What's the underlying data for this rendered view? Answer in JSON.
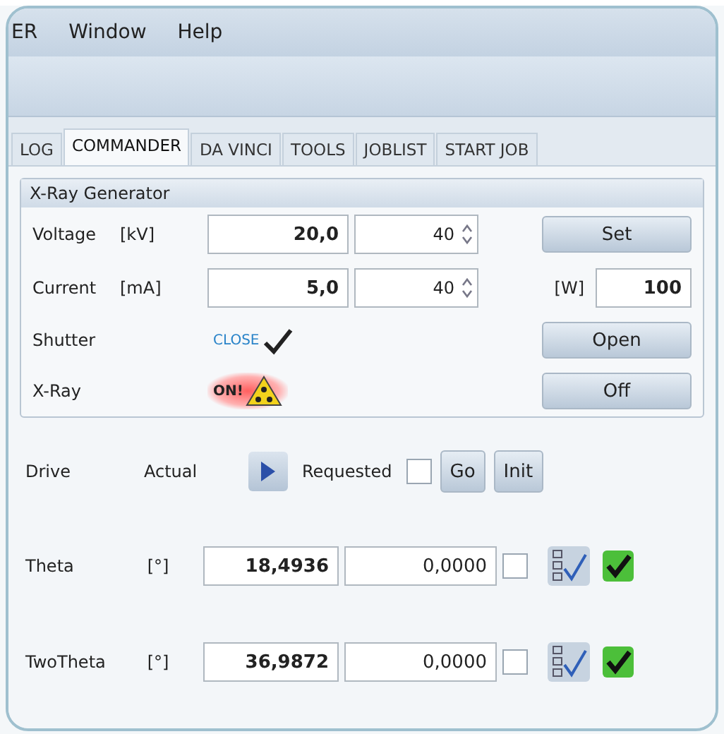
{
  "menu": [
    {
      "label": "ER"
    },
    {
      "label": "Window"
    },
    {
      "label": "Help"
    }
  ],
  "tabs": [
    {
      "label": "LOG",
      "selected": false
    },
    {
      "label": "COMMANDER",
      "selected": true
    },
    {
      "label": "DA VINCI",
      "selected": false
    },
    {
      "label": "TOOLS",
      "selected": false
    },
    {
      "label": "JOBLIST",
      "selected": false
    },
    {
      "label": "START JOB",
      "selected": false
    }
  ],
  "xray_generator": {
    "title": "X-Ray Generator",
    "setpoints": [
      {
        "label": "Voltage",
        "unit": "[kV]",
        "actual": "20,0",
        "requested": "40",
        "extra": {
          "kind": "button",
          "label": "Set"
        }
      },
      {
        "label": "Current",
        "unit": "[mA]",
        "actual": "5,0",
        "requested": "40",
        "extra": {
          "kind": "field",
          "label": "[W]",
          "value": "100"
        }
      }
    ],
    "statuses": [
      {
        "kind": "shutter",
        "label": "Shutter",
        "status": "CLOSE",
        "button": "Open"
      },
      {
        "kind": "xray",
        "label": "X-Ray",
        "status": "ON!",
        "button": "Off"
      }
    ]
  },
  "drive": {
    "label": "Drive",
    "actual_label": "Actual",
    "requested_label": "Requested",
    "checked": false,
    "go": "Go",
    "init": "Init",
    "axes": [
      {
        "name": "Theta",
        "unit": "[°]",
        "actual": "18,4936",
        "requested": "0,0000",
        "checked": false,
        "ready": true
      },
      {
        "name": "TwoTheta",
        "unit": "[°]",
        "actual": "36,9872",
        "requested": "0,0000",
        "checked": false,
        "ready": true
      }
    ]
  }
}
